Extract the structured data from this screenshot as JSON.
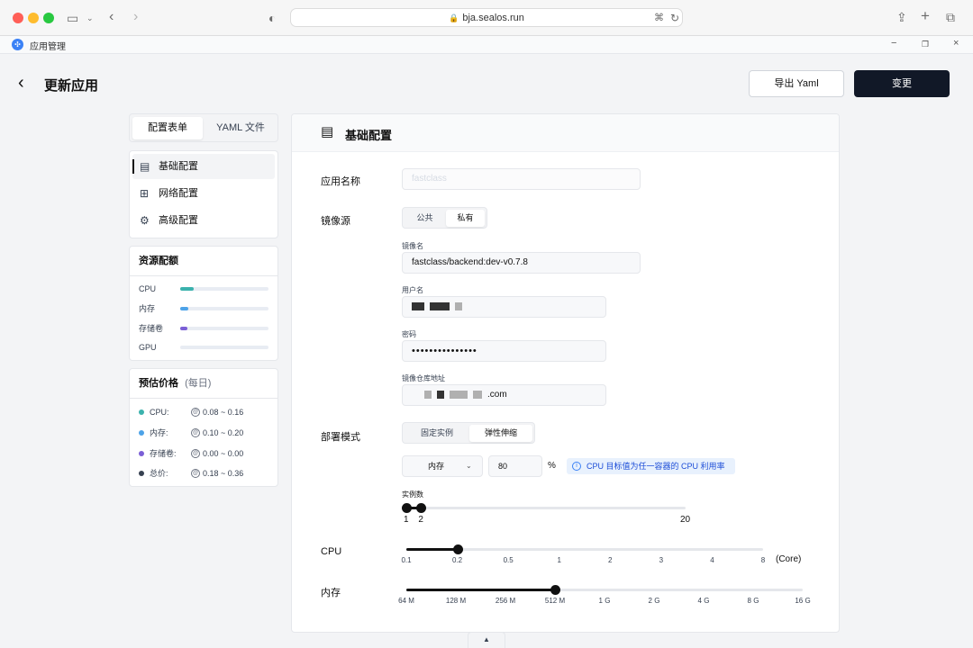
{
  "browser": {
    "url": "bja.sealos.run"
  },
  "window": {
    "title": "应用管理",
    "controls": {
      "minimize": "−",
      "restore": "❐",
      "close": "×"
    }
  },
  "header": {
    "title": "更新应用",
    "export_label": "导出 Yaml",
    "change_label": "变更"
  },
  "tabs": {
    "form": "配置表单",
    "yaml": "YAML 文件"
  },
  "nav": {
    "items": [
      {
        "label": "基础配置",
        "icon": "document-icon",
        "active": true
      },
      {
        "label": "网络配置",
        "icon": "network-icon",
        "active": false
      },
      {
        "label": "高级配置",
        "icon": "gear-icon",
        "active": false
      }
    ]
  },
  "resources": {
    "title": "资源配额",
    "items": [
      {
        "label": "CPU",
        "fraction": 0.15,
        "color": "#3bb2ad"
      },
      {
        "label": "内存",
        "fraction": 0.09,
        "color": "#4da3e8"
      },
      {
        "label": "存储卷",
        "fraction": 0.08,
        "color": "#7b5fd6"
      },
      {
        "label": "GPU",
        "fraction": 0.0,
        "color": "#cbd5e1"
      }
    ]
  },
  "price": {
    "title": "预估价格",
    "period": "(每日)",
    "items": [
      {
        "label": "CPU:",
        "value": "0.08 ~ 0.16",
        "color": "#3bb2ad"
      },
      {
        "label": "内存:",
        "value": "0.10 ~ 0.20",
        "color": "#4da3e8"
      },
      {
        "label": "存储卷:",
        "value": "0.00 ~ 0.00",
        "color": "#7b5fd6"
      },
      {
        "label": "总价:",
        "value": "0.18 ~ 0.36",
        "color": "#374151"
      }
    ]
  },
  "basic": {
    "section_title": "基础配置",
    "app_name_label": "应用名称",
    "app_name_value": "fastclass",
    "image_source_label": "镜像源",
    "image_source_options": [
      "公共",
      "私有"
    ],
    "image_source_selected": "私有",
    "image_name_label": "镜像名",
    "image_name_value": "fastclass/backend:dev-v0.7.8",
    "username_label": "用户名",
    "password_label": "密码",
    "password_value": "•••••••••••••••",
    "registry_label": "镜像仓库地址",
    "registry_suffix": ".com",
    "deploy_mode_label": "部署模式",
    "deploy_mode_options": [
      "固定实例",
      "弹性伸缩"
    ],
    "deploy_mode_selected": "弹性伸缩",
    "metric_select": "内存",
    "metric_value": "80",
    "percent_sign": "%",
    "tip": "CPU 目标值为任一容器的 CPU 利用率",
    "instances_label": "实例数",
    "instances_min": 1,
    "instances_max": 2,
    "instances_range_max": 20,
    "cpu_label": "CPU",
    "cpu_ticks": [
      "0.1",
      "0.2",
      "0.5",
      "1",
      "2",
      "3",
      "4",
      "8"
    ],
    "cpu_selected": "0.2",
    "cpu_unit": "(Core)",
    "memory_label": "内存",
    "memory_ticks": [
      "64 M",
      "128 M",
      "256 M",
      "512 M",
      "1 G",
      "2 G",
      "4 G",
      "8 G",
      "16 G"
    ],
    "memory_selected": "512 M"
  }
}
